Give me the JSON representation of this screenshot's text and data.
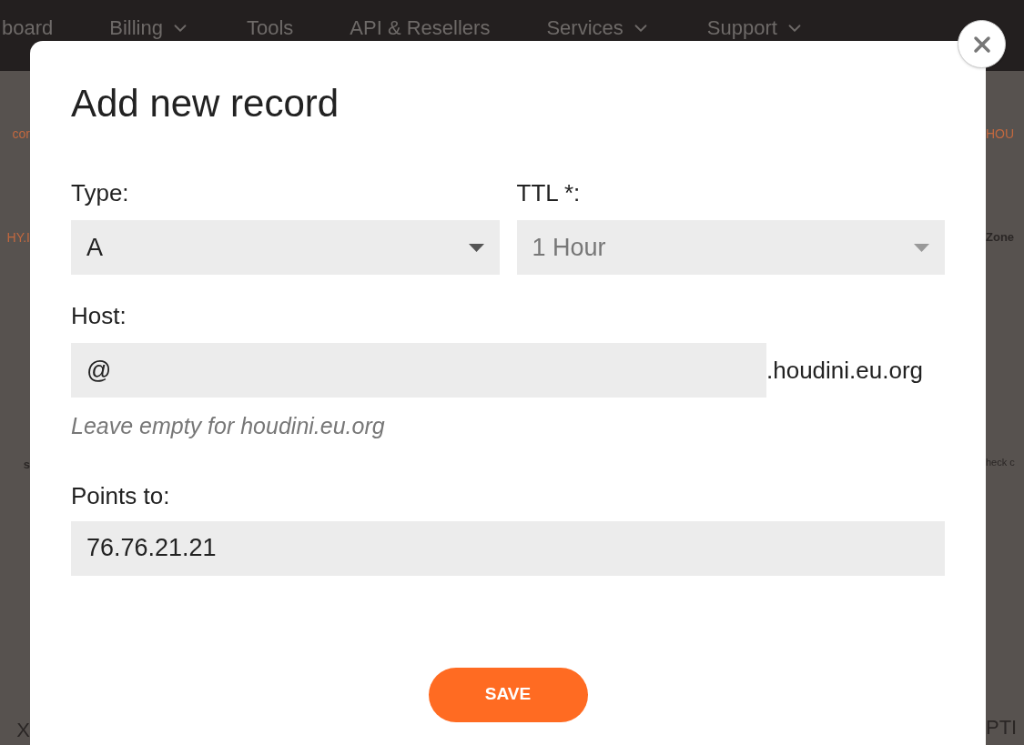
{
  "nav": [
    {
      "label": "board",
      "dropdown": false
    },
    {
      "label": "Billing",
      "dropdown": true
    },
    {
      "label": "Tools",
      "dropdown": false
    },
    {
      "label": "API & Resellers",
      "dropdown": false
    },
    {
      "label": "Services",
      "dropdown": true
    },
    {
      "label": "Support",
      "dropdown": true
    }
  ],
  "background": {
    "left": [
      {
        "text": "cor",
        "kind": "link"
      },
      {
        "text": "HY.I",
        "kind": "link"
      },
      {
        "text": "s",
        "kind": "label"
      },
      {
        "text": "X",
        "kind": "large"
      }
    ],
    "right": [
      {
        "text": "HOU",
        "kind": "link"
      },
      {
        "text": "Zone",
        "kind": "label"
      },
      {
        "text": "heck c",
        "kind": "small"
      },
      {
        "text": "PTI",
        "kind": "large"
      }
    ]
  },
  "dialog": {
    "title": "Add new record",
    "type": {
      "label": "Type:",
      "value": "A",
      "disabled": false
    },
    "ttl": {
      "label": "TTL *:",
      "value": "1 Hour",
      "disabled": true
    },
    "host": {
      "label": "Host:",
      "value": "@",
      "suffix": ".houdini.eu.org",
      "hint": "Leave empty for houdini.eu.org"
    },
    "points_to": {
      "label": "Points to:",
      "value": "76.76.21.21"
    },
    "save": "SAVE"
  }
}
